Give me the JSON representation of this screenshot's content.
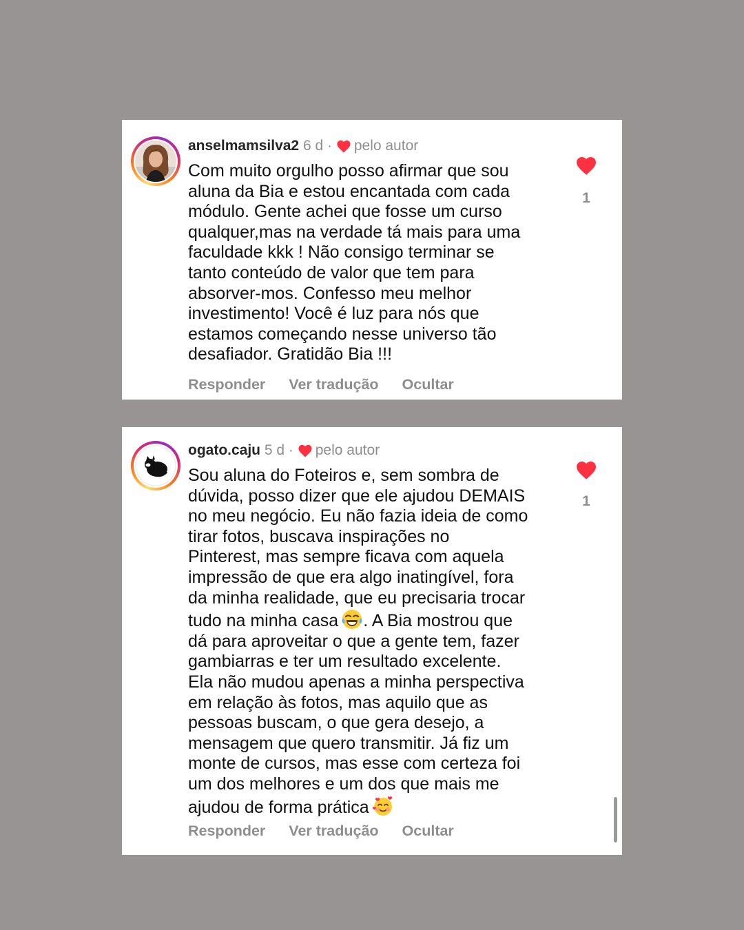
{
  "colors": {
    "background": "#979493",
    "card": "#ffffff",
    "heart": "#ff3040",
    "muted_text": "#8e8e8e",
    "body_text": "#111111"
  },
  "comments": [
    {
      "username": "anselmamsilva2",
      "time": "6 d",
      "separator": "·",
      "liked_by_author_label": "pelo autor",
      "text": "Com muito orgulho posso afirmar que sou\naluna da Bia e estou encantada com cada\nmódulo.  Gente achei que fosse um curso\nqualquer,mas na verdade tá mais para uma\nfaculdade kkk ! Não consigo terminar se\ntanto conteúdo de valor que tem para\nabsorver-mos. Confesso meu melhor\ninvestimento! Você é luz para nós que\nestamos começando nesse universo tão\ndesafiador. Gratidão Bia !!!",
      "like_count": "1",
      "actions": [
        "Responder",
        "Ver tradução",
        "Ocultar"
      ],
      "avatar_icon": "profile-photo-woman"
    },
    {
      "username": "ogato.caju",
      "time": "5 d",
      "separator": "·",
      "liked_by_author_label": "pelo autor",
      "text_part1": "Sou aluna do Foteiros e, sem sombra de\ndúvida, posso dizer que ele ajudou DEMAIS\nno meu negócio. Eu não fazia ideia de como\ntirar fotos, buscava inspirações no\nPinterest, mas sempre ficava com aquela\nimpressão de que era algo inatingível, fora\nda minha realidade, que eu precisaria trocar\ntudo na minha casa",
      "text_part2": ". A Bia mostrou que\ndá para aproveitar o que a gente tem, fazer\ngambiarras e ter um resultado excelente.\nEla não mudou apenas a minha perspectiva\nem relação às fotos, mas aquilo que as\npessoas buscam, o que gera desejo, a\nmensagem que quero transmitir. Já fiz um\nmonte de cursos, mas esse com certeza foi\num dos melhores e um dos que mais me\najudou de forma prática",
      "emoji_1": "face-with-tears-of-joy",
      "emoji_2": "smiling-face-with-hearts",
      "like_count": "1",
      "actions": [
        "Responder",
        "Ver tradução",
        "Ocultar"
      ],
      "avatar_icon": "black-cat-logo"
    }
  ]
}
